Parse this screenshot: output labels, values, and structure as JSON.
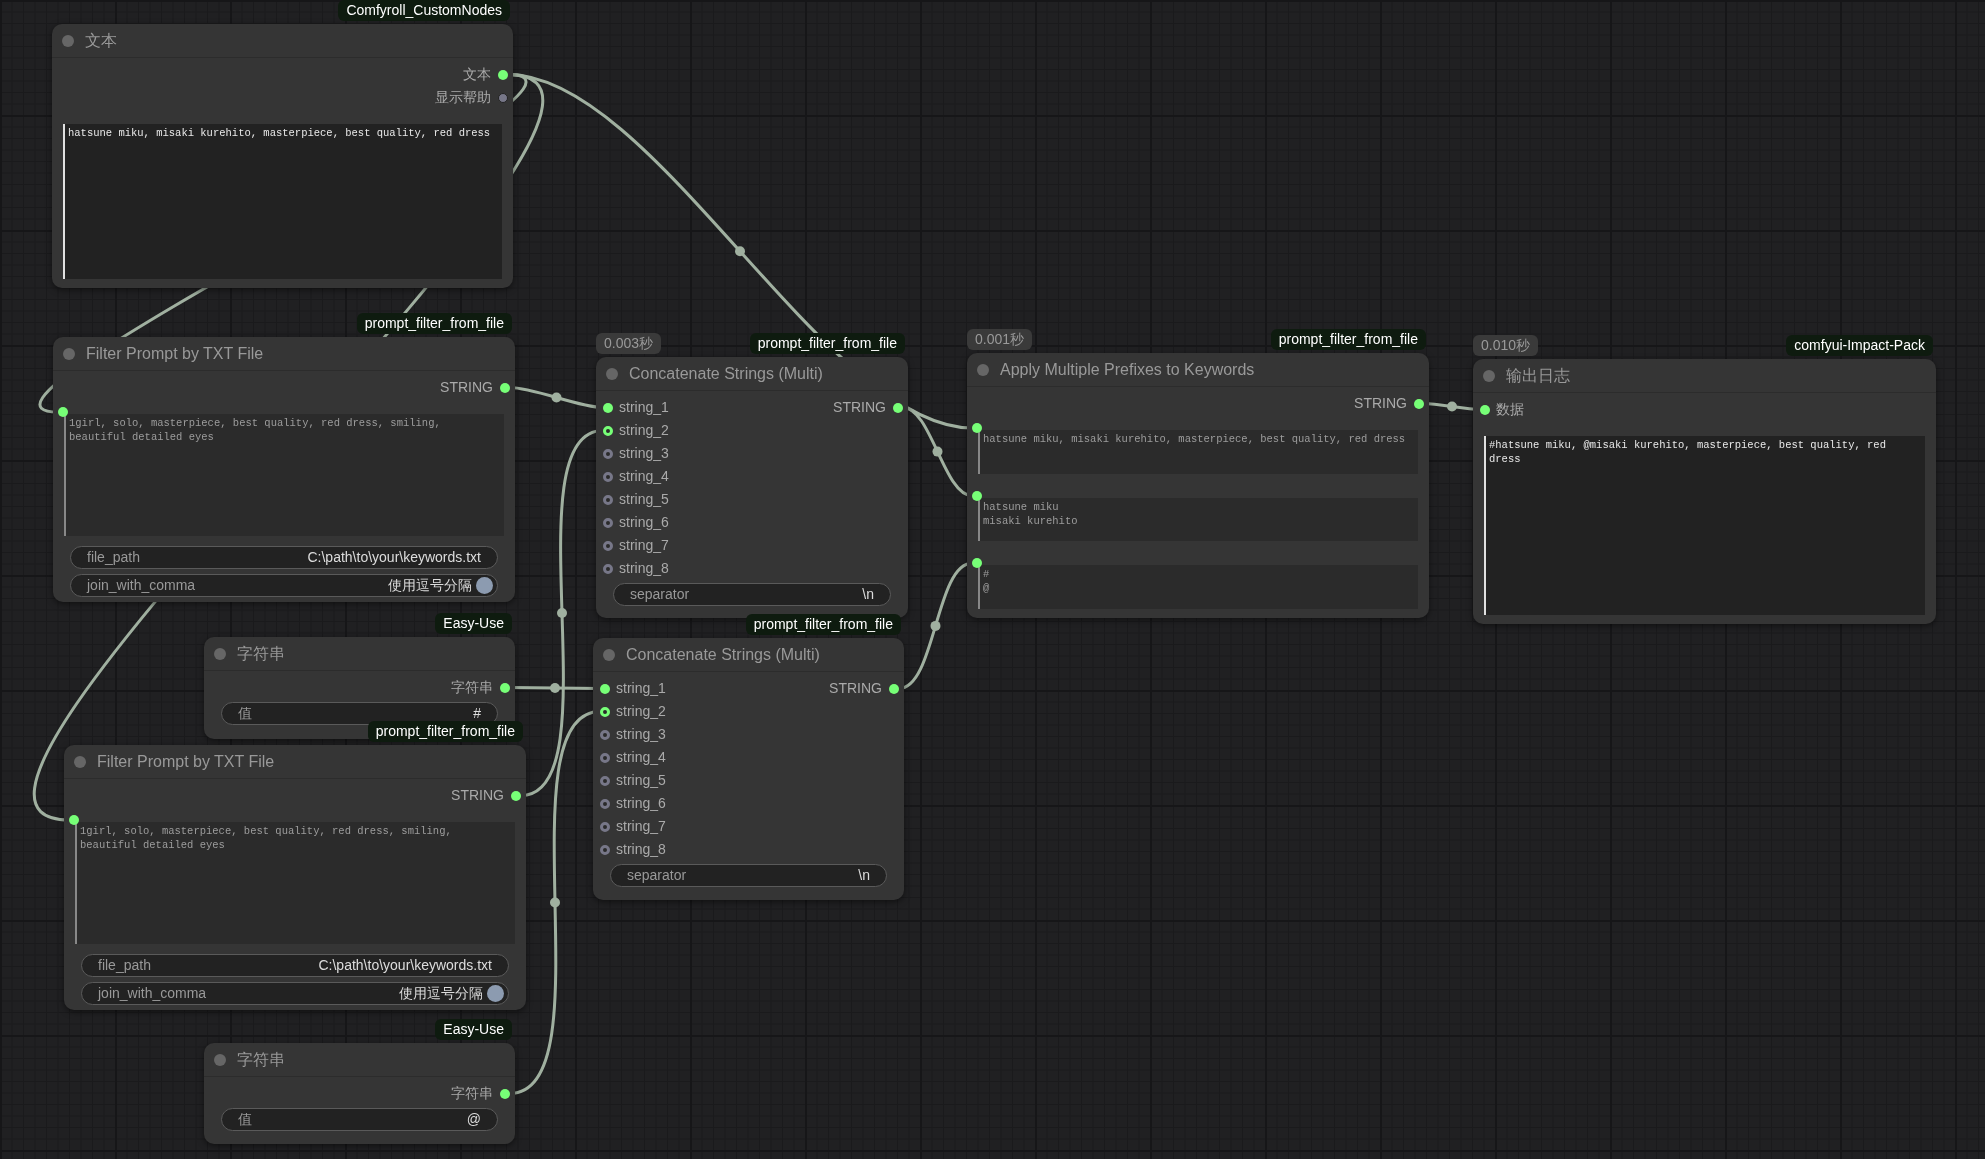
{
  "nodes": [
    {
      "title": "文本",
      "source": "Comfyroll_CustomNodes",
      "outputs": [
        {
          "label": "文本",
          "connected": true
        },
        {
          "label": "显示帮助",
          "connected": false
        }
      ],
      "widgets": [
        {
          "kind": "textarea",
          "value": "hatsune miku, misaki kurehito, masterpiece, best quality, red dress",
          "linked": false
        }
      ]
    },
    {
      "title": "Filter Prompt by TXT File",
      "source": "prompt_filter_from_file",
      "outputs": [
        {
          "label": "STRING",
          "connected": true
        }
      ],
      "widgets": [
        {
          "kind": "textarea",
          "value": "1girl, solo, masterpiece, best quality, red dress, smiling, beautiful detailed eyes",
          "linked": true
        },
        {
          "kind": "text",
          "label": "file_path",
          "value": "C:\\path\\to\\your\\keywords.txt"
        },
        {
          "kind": "toggle",
          "label": "join_with_comma",
          "value": "使用逗号分隔",
          "on": true
        }
      ]
    },
    {
      "title": "字符串",
      "source": "Easy-Use",
      "outputs": [
        {
          "label": "字符串",
          "connected": true
        }
      ],
      "widgets": [
        {
          "kind": "text",
          "label": "值",
          "value": "#"
        }
      ]
    },
    {
      "title": "Filter Prompt by TXT File",
      "source": "prompt_filter_from_file",
      "outputs": [
        {
          "label": "STRING",
          "connected": true
        }
      ],
      "widgets": [
        {
          "kind": "textarea",
          "value": "1girl, solo, masterpiece, best quality, red dress, smiling, beautiful detailed eyes",
          "linked": true
        },
        {
          "kind": "text",
          "label": "file_path",
          "value": "C:\\path\\to\\your\\keywords.txt"
        },
        {
          "kind": "toggle",
          "label": "join_with_comma",
          "value": "使用逗号分隔",
          "on": true
        }
      ]
    },
    {
      "title": "字符串",
      "source": "Easy-Use",
      "outputs": [
        {
          "label": "字符串",
          "connected": true
        }
      ],
      "widgets": [
        {
          "kind": "text",
          "label": "值",
          "value": "@"
        }
      ]
    },
    {
      "title": "Concatenate Strings (Multi)",
      "timing": "0.003秒",
      "source": "prompt_filter_from_file",
      "inputs": [
        {
          "label": "string_1",
          "kind": "required",
          "connected": true
        },
        {
          "label": "string_2",
          "kind": "optional",
          "connected": true
        },
        {
          "label": "string_3",
          "kind": "optional",
          "connected": false
        },
        {
          "label": "string_4",
          "kind": "optional",
          "connected": false
        },
        {
          "label": "string_5",
          "kind": "optional",
          "connected": false
        },
        {
          "label": "string_6",
          "kind": "optional",
          "connected": false
        },
        {
          "label": "string_7",
          "kind": "optional",
          "connected": false
        },
        {
          "label": "string_8",
          "kind": "optional",
          "connected": false
        }
      ],
      "outputs": [
        {
          "label": "STRING",
          "connected": true
        }
      ],
      "widgets": [
        {
          "kind": "text",
          "label": "separator",
          "value": "\\n"
        }
      ]
    },
    {
      "title": "Concatenate Strings (Multi)",
      "source": "prompt_filter_from_file",
      "inputs": [
        {
          "label": "string_1",
          "kind": "required",
          "connected": true
        },
        {
          "label": "string_2",
          "kind": "optional",
          "connected": true
        },
        {
          "label": "string_3",
          "kind": "optional",
          "connected": false
        },
        {
          "label": "string_4",
          "kind": "optional",
          "connected": false
        },
        {
          "label": "string_5",
          "kind": "optional",
          "connected": false
        },
        {
          "label": "string_6",
          "kind": "optional",
          "connected": false
        },
        {
          "label": "string_7",
          "kind": "optional",
          "connected": false
        },
        {
          "label": "string_8",
          "kind": "optional",
          "connected": false
        }
      ],
      "outputs": [
        {
          "label": "STRING",
          "connected": true
        }
      ],
      "widgets": [
        {
          "kind": "text",
          "label": "separator",
          "value": "\\n"
        }
      ]
    },
    {
      "title": "Apply Multiple Prefixes to Keywords",
      "timing": "0.001秒",
      "source": "prompt_filter_from_file",
      "outputs": [
        {
          "label": "STRING",
          "connected": true
        }
      ],
      "widgets": [
        {
          "kind": "textarea",
          "value": "hatsune miku, misaki kurehito, masterpiece, best quality, red dress",
          "linked": true
        },
        {
          "kind": "textarea",
          "value": "hatsune miku\nmisaki kurehito",
          "linked": true
        },
        {
          "kind": "textarea",
          "value": "#\n@",
          "linked": true
        }
      ]
    },
    {
      "title": "输出日志",
      "timing": "0.010秒",
      "source": "comfyui-Impact-Pack",
      "inputs": [
        {
          "label": "数据",
          "kind": "required",
          "connected": true
        }
      ],
      "widgets": [
        {
          "kind": "textarea",
          "value": "#hatsune miku, @misaki kurehito, masterpiece, best quality, red dress",
          "linked": false
        }
      ]
    }
  ]
}
